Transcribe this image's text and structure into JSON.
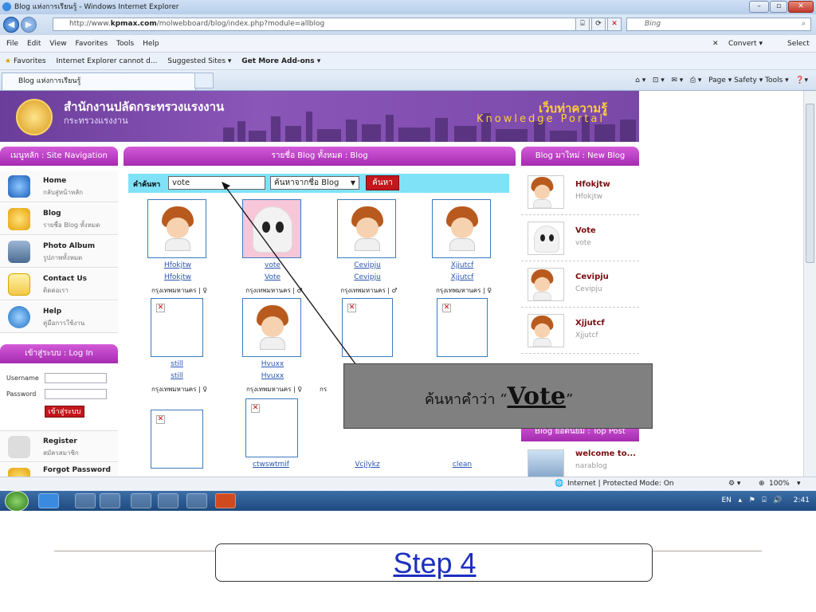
{
  "browser": {
    "title": "Blog แห่งการเรียนรู้ - Windows Internet Explorer",
    "url_prefix": "http://www.",
    "url_domain": "kpmax.com",
    "url_path": "/molwebboard/blog/index.php?module=allblog",
    "search_placeholder": "Bing",
    "menu": [
      "File",
      "Edit",
      "View",
      "Favorites",
      "Tools",
      "Help"
    ],
    "menu_right": [
      "Convert ▾",
      "Select"
    ],
    "favorites": [
      "Favorites",
      "Internet Explorer cannot d...",
      "Suggested Sites ▾",
      "Get More Add-ons ▾"
    ],
    "tab_label": "Blog แห่งการเรียนรู้",
    "command_bar": "Page ▾   Safety ▾   Tools ▾",
    "status": "Internet | Protected Mode: On",
    "zoom": "100%"
  },
  "page": {
    "org_title": "สำนักงานปลัดกระทรวงแรงงาน",
    "org_sub": "กระทรวงแรงงาน",
    "kp_title": "เว็บท่าความรู้",
    "kp_sub": "Knowledge Portal",
    "left_head": "เมนูหลัก : Site Navigation",
    "nav": [
      {
        "title": "Home",
        "sub": "กลับสู่หน้าหลัก"
      },
      {
        "title": "Blog",
        "sub": "รายชื่อ Blog ทั้งหมด"
      },
      {
        "title": "Photo Album",
        "sub": "รูปภาพทั้งหมด"
      },
      {
        "title": "Contact Us",
        "sub": "ติดต่อเรา"
      },
      {
        "title": "Help",
        "sub": "คู่มือการใช้งาน"
      }
    ],
    "login_head": "เข้าสู่ระบบ : Log In",
    "username_label": "Username",
    "password_label": "Password",
    "login_button": "เข้าสู่ระบบ",
    "bottom_nav": [
      {
        "title": "Register",
        "sub": "สมัครสมาชิก"
      },
      {
        "title": "Forgot Password",
        "sub": ""
      }
    ],
    "mid_head": "รายชื่อ Blog ทั้งหมด : Blog",
    "search_label": "คำค้นหา",
    "search_value": "vote",
    "search_select": "ค้นหาจากชื่อ Blog",
    "search_button": "ค้นหา",
    "blogs": [
      {
        "n1": "Hfokjtw",
        "n2": "Hfokjtw",
        "loc": "กรุงเทพมหานคร | ♀"
      },
      {
        "n1": "vote",
        "n2": "Vote",
        "loc": "กรุงเทพมหานคร | ♂"
      },
      {
        "n1": "Cevipju",
        "n2": "Cevipju",
        "loc": "กรุงเทพมหานคร | ♂"
      },
      {
        "n1": "Xjjutcf",
        "n2": "Xjjutcf",
        "loc": "กรุงเทพมหานคร | ♀"
      },
      {
        "n1": "still",
        "n2": "still",
        "loc": "กรุงเทพมหานคร | ♀"
      },
      {
        "n1": "Hvuxx",
        "n2": "Hvuxx",
        "loc": "กรุงเทพมหานคร | ♀"
      },
      {
        "n1": "ctwswtmif",
        "n2": "",
        "loc": ""
      },
      {
        "n1": "Vcjlykz",
        "n2": "",
        "loc": ""
      },
      {
        "n1": "clean",
        "n2": "",
        "loc": ""
      }
    ],
    "loc_partial": "กร",
    "right_head": "Blog มาใหม่ : New Blog",
    "new_blogs": [
      {
        "name": "Hfokjtw",
        "sub": "Hfokjtw"
      },
      {
        "name": "Vote",
        "sub": "vote"
      },
      {
        "name": "Cevipju",
        "sub": "Cevipju"
      },
      {
        "name": "Xjjutcf",
        "sub": "Xjjutcf"
      }
    ],
    "top_head": "Blog ยอดนิยม : Top Post",
    "top_post": {
      "name": "welcome to...",
      "sub": "narablog"
    }
  },
  "taskbar": {
    "lang": "EN",
    "time": "2:41"
  },
  "callout": {
    "text_prefix": "ค้นหาคำว่า “",
    "text_bold": "Vote",
    "text_suffix": "”"
  },
  "slide": {
    "step_label": "Step 4"
  }
}
